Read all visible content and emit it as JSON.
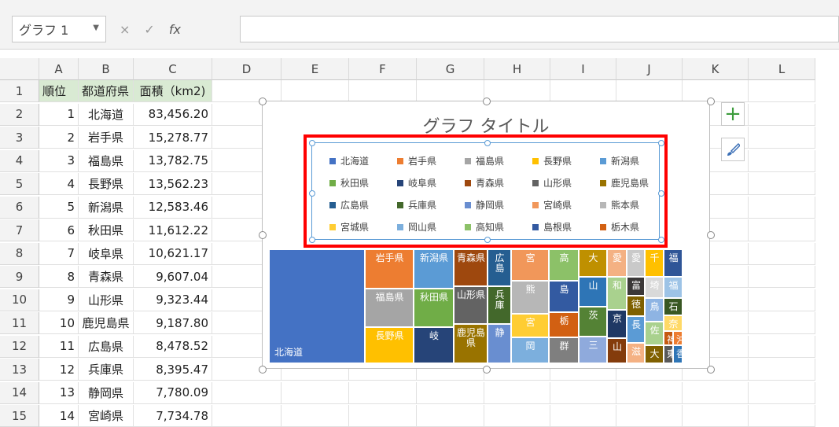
{
  "name_box": {
    "value": "グラフ 1",
    "dropdown_icon": "chevron-down-icon"
  },
  "formula_buttons": {
    "cancel": "×",
    "enter": "✓",
    "fx": "fx"
  },
  "columns": [
    "A",
    "B",
    "C",
    "D",
    "E",
    "F",
    "G",
    "H",
    "I",
    "J",
    "K",
    "L"
  ],
  "rows": [
    "1",
    "2",
    "3",
    "4",
    "5",
    "6",
    "7",
    "8",
    "9",
    "10",
    "11",
    "12",
    "13",
    "14",
    "15"
  ],
  "table": {
    "headers": [
      "順位",
      "都道府県",
      "面積（km2)"
    ],
    "data": [
      [
        "1",
        "北海道",
        "83,456.20"
      ],
      [
        "2",
        "岩手県",
        "15,278.77"
      ],
      [
        "3",
        "福島県",
        "13,782.75"
      ],
      [
        "4",
        "長野県",
        "13,562.23"
      ],
      [
        "5",
        "新潟県",
        "12,583.46"
      ],
      [
        "6",
        "秋田県",
        "11,612.22"
      ],
      [
        "7",
        "岐阜県",
        "10,621.17"
      ],
      [
        "8",
        "青森県",
        "9,607.04"
      ],
      [
        "9",
        "山形県",
        "9,323.44"
      ],
      [
        "10",
        "鹿児島県",
        "9,187.80"
      ],
      [
        "11",
        "広島県",
        "8,478.52"
      ],
      [
        "12",
        "兵庫県",
        "8,395.47"
      ],
      [
        "13",
        "静岡県",
        "7,780.09"
      ],
      [
        "14",
        "宮崎県",
        "7,734.78"
      ]
    ]
  },
  "chart": {
    "title": "グラフ タイトル",
    "legend": [
      {
        "label": "北海道",
        "color": "#4472c4"
      },
      {
        "label": "岩手県",
        "color": "#ed7d31"
      },
      {
        "label": "福島県",
        "color": "#a5a5a5"
      },
      {
        "label": "長野県",
        "color": "#ffc000"
      },
      {
        "label": "新潟県",
        "color": "#5b9bd5"
      },
      {
        "label": "秋田県",
        "color": "#70ad47"
      },
      {
        "label": "岐阜県",
        "color": "#264478"
      },
      {
        "label": "青森県",
        "color": "#9e480e"
      },
      {
        "label": "山形県",
        "color": "#636363"
      },
      {
        "label": "鹿児島県",
        "color": "#997300"
      },
      {
        "label": "広島県",
        "color": "#255e91"
      },
      {
        "label": "兵庫県",
        "color": "#43682b"
      },
      {
        "label": "静岡県",
        "color": "#698ed0"
      },
      {
        "label": "宮崎県",
        "color": "#f1975a"
      },
      {
        "label": "熊本県",
        "color": "#b7b7b7"
      },
      {
        "label": "宮城県",
        "color": "#ffcd33"
      },
      {
        "label": "岡山県",
        "color": "#7cafdd"
      },
      {
        "label": "高知県",
        "color": "#8cc168"
      },
      {
        "label": "島根県",
        "color": "#335aa1"
      },
      {
        "label": "栃木県",
        "color": "#d26012"
      }
    ],
    "tiles": [
      {
        "label": "北海道",
        "color": "#4472c4"
      },
      {
        "label": "岩手県",
        "color": "#ed7d31"
      },
      {
        "label": "福島県",
        "color": "#a5a5a5"
      },
      {
        "label": "長野県",
        "color": "#ffc000"
      },
      {
        "label": "新潟県",
        "color": "#5b9bd5"
      },
      {
        "label": "秋田県",
        "color": "#70ad47"
      },
      {
        "label": "岐",
        "color": "#264478"
      },
      {
        "label": "青森県",
        "color": "#9e480e"
      },
      {
        "label": "山形県",
        "color": "#636363"
      },
      {
        "label": "鹿児島県",
        "color": "#997300"
      },
      {
        "label": "広島",
        "color": "#255e91"
      },
      {
        "label": "兵庫",
        "color": "#43682b"
      },
      {
        "label": "静",
        "color": "#698ed0"
      },
      {
        "label": "宮",
        "color": "#f1975a"
      },
      {
        "label": "熊",
        "color": "#b7b7b7"
      },
      {
        "label": "宮",
        "color": "#ffcd33"
      },
      {
        "label": "岡",
        "color": "#7cafdd"
      },
      {
        "label": "高",
        "color": "#8cc168"
      },
      {
        "label": "島",
        "color": "#335aa1"
      },
      {
        "label": "栃",
        "color": "#d26012"
      },
      {
        "label": "群",
        "color": "#7f7f7f"
      },
      {
        "label": "大",
        "color": "#bf9000"
      },
      {
        "label": "山",
        "color": "#2e75b6"
      },
      {
        "label": "茨",
        "color": "#548235"
      },
      {
        "label": "三",
        "color": "#8faadc"
      },
      {
        "label": "愛",
        "color": "#f4b183"
      },
      {
        "label": "和",
        "color": "#a9d18e"
      },
      {
        "label": "京",
        "color": "#1f3864"
      },
      {
        "label": "山",
        "color": "#843c0c"
      },
      {
        "label": "愛",
        "color": "#c9c9c9"
      },
      {
        "label": "富",
        "color": "#3b3838"
      },
      {
        "label": "徳",
        "color": "#7f6000"
      },
      {
        "label": "長",
        "color": "#5b9bd5"
      },
      {
        "label": "滋",
        "color": "#f4b183"
      },
      {
        "label": "千",
        "color": "#ffc000"
      },
      {
        "label": "福",
        "color": "#2f5597"
      },
      {
        "label": "埼",
        "color": "#d9d9d9"
      },
      {
        "label": "鳥",
        "color": "#8eb4e3"
      },
      {
        "label": "佐",
        "color": "#a9d18e"
      },
      {
        "label": "福",
        "color": "#9dc3e6"
      },
      {
        "label": "石",
        "color": "#385723"
      },
      {
        "label": "奈",
        "color": "#ffd966"
      },
      {
        "label": "神",
        "color": "#c55a11"
      },
      {
        "label": "沖",
        "color": "#ed7d31"
      },
      {
        "label": "大",
        "color": "#806000"
      },
      {
        "label": "東",
        "color": "#595959"
      },
      {
        "label": "香",
        "color": "#2e75b6"
      }
    ]
  },
  "side_buttons": {
    "add": "plus-icon",
    "style": "brush-icon"
  }
}
